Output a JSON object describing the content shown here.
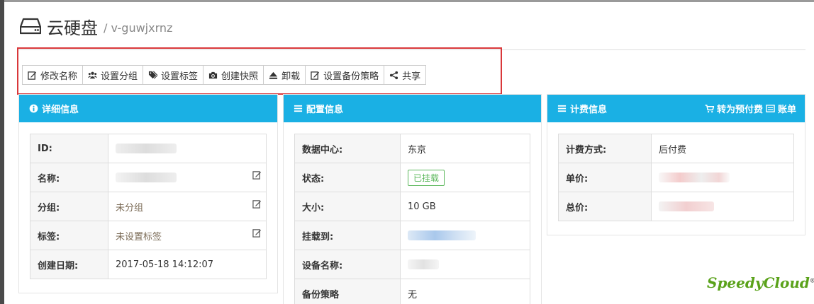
{
  "header": {
    "title": "云硬盘",
    "subtitle": "/ v-guwjxrnz"
  },
  "toolbar": {
    "buttons": [
      {
        "label": "修改名称",
        "icon": "edit-icon"
      },
      {
        "label": "设置分组",
        "icon": "users-icon"
      },
      {
        "label": "设置标签",
        "icon": "tags-icon"
      },
      {
        "label": "创建快照",
        "icon": "camera-icon"
      },
      {
        "label": "卸载",
        "icon": "eject-icon"
      },
      {
        "label": "设置备份策略",
        "icon": "edit-icon"
      },
      {
        "label": "共享",
        "icon": "share-icon"
      }
    ]
  },
  "detail_panel": {
    "title": "详细信息",
    "rows": [
      {
        "key": "ID:",
        "value": ""
      },
      {
        "key": "名称:",
        "value": ""
      },
      {
        "key": "分组:",
        "value": "未分组"
      },
      {
        "key": "标签:",
        "value": "未设置标签"
      },
      {
        "key": "创建日期:",
        "value": "2017-05-18 14:12:07"
      }
    ]
  },
  "config_panel": {
    "title": "配置信息",
    "rows": [
      {
        "key": "数据中心:",
        "value": "东京"
      },
      {
        "key": "状态:",
        "value": "已挂载"
      },
      {
        "key": "大小:",
        "value": "10 GB"
      },
      {
        "key": "挂载到:",
        "value": ""
      },
      {
        "key": "设备名称:",
        "value": ""
      },
      {
        "key": "备份策略",
        "value": "无"
      }
    ]
  },
  "billing_panel": {
    "title": "计费信息",
    "prepay_label": "转为预付费",
    "bill_label": "账单",
    "rows": [
      {
        "key": "计费方式:",
        "value": "后付费"
      },
      {
        "key": "单价:",
        "value": ""
      },
      {
        "key": "总价:",
        "value": ""
      }
    ]
  },
  "logo": {
    "text": "SpeedyCloud",
    "mark": "®"
  },
  "colors": {
    "panel_header": "#1ab0e4",
    "highlight_border": "#d9373a",
    "status_green": "#5cb85c",
    "logo_green": "#5aa21a"
  }
}
